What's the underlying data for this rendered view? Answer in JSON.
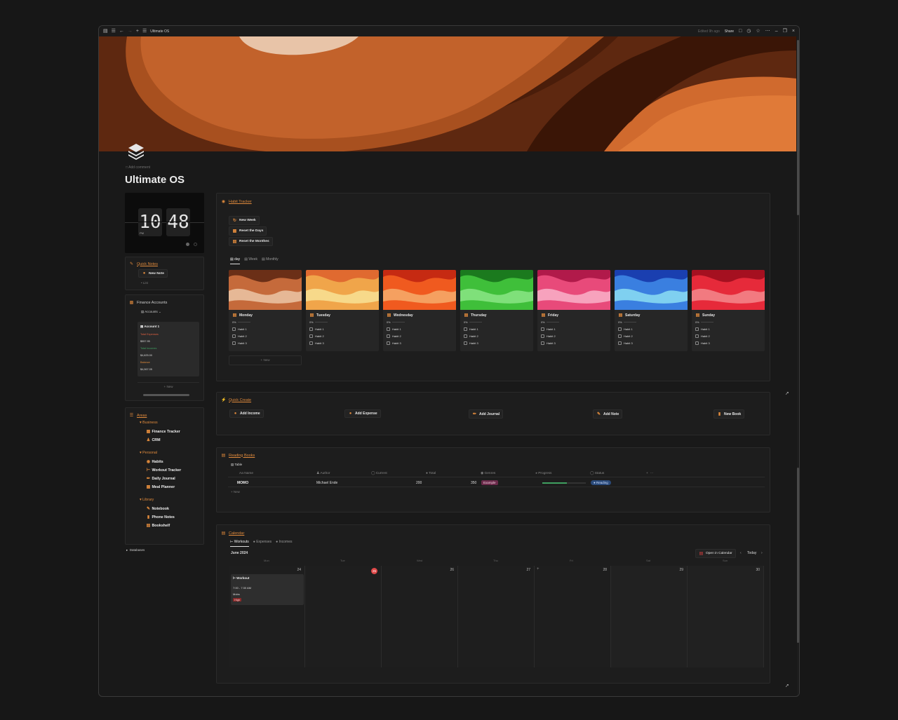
{
  "window": {
    "title": "Ultimate OS",
    "edited": "Edited 9h ago",
    "share": "Share"
  },
  "page": {
    "add_comment": "Add comment",
    "title": "Ultimate OS"
  },
  "clock": {
    "hours": "10",
    "minutes": "48",
    "ampm": "PM"
  },
  "quick_notes": {
    "title": "Quick Notes",
    "new_note": "New Note",
    "list_item": "List"
  },
  "finance": {
    "title": "Finance Accounts",
    "view": "Accounts",
    "account": "Account 1",
    "total_expenses_label": "Total Expenses",
    "total_expenses": "$557.95",
    "total_incomes_label": "Total Incomes",
    "total_incomes": "$4,625.00",
    "balance_label": "Balance",
    "balance": "$4,067.05",
    "new": "New"
  },
  "areas": {
    "title": "Areas",
    "business": "Business",
    "finance_tracker": "Finance Tracker",
    "crm": "CRM",
    "personal": "Personal",
    "habits": "Habits",
    "workout": "Workout Tracker",
    "journal": "Daily Journal",
    "meal": "Meal Planner",
    "library": "Library",
    "notebook": "Notebook",
    "phone_notes": "Phone Notes",
    "bookshelf": "Bookshelf",
    "databases": "Databases"
  },
  "habit": {
    "title": "Habit Tracker",
    "new_week": "New Week",
    "reset_days": "Reset the Days",
    "reset_months": "Reset the Monthes",
    "tabs": [
      "day",
      "Week",
      "Monthly"
    ],
    "new": "New",
    "days": [
      {
        "name": "Monday",
        "pct": "0%",
        "h1": "Habit 1",
        "h2": "Habit 2",
        "h3": "Habit 3",
        "c1": "#c56a3b",
        "c2": "#6b2f17",
        "c3": "#e6b896"
      },
      {
        "name": "Tuesday",
        "pct": "0%",
        "h1": "Habit 1",
        "h2": "Habit 2",
        "h3": "Habit 3",
        "c1": "#f0a54a",
        "c2": "#e06a30",
        "c3": "#f7d98a"
      },
      {
        "name": "Wednesday",
        "pct": "0%",
        "h1": "Habit 1",
        "h2": "Habit 2",
        "h3": "Habit 3",
        "c1": "#f05a1f",
        "c2": "#c62a12",
        "c3": "#f5a060"
      },
      {
        "name": "Thursday",
        "pct": "0%",
        "h1": "Habit 1",
        "h2": "Habit 2",
        "h3": "Habit 3",
        "c1": "#3fbf3a",
        "c2": "#1b7a1e",
        "c3": "#7fe07a"
      },
      {
        "name": "Friday",
        "pct": "0%",
        "h1": "Habit 1",
        "h2": "Habit 2",
        "h3": "Habit 3",
        "c1": "#e84a7a",
        "c2": "#b11a4a",
        "c3": "#f7a2bd"
      },
      {
        "name": "Saturday",
        "pct": "0%",
        "h1": "Habit 1",
        "h2": "Habit 2",
        "h3": "Habit 3",
        "c1": "#3a7fe0",
        "c2": "#1a3fb0",
        "c3": "#7fd0f0"
      },
      {
        "name": "Sunday",
        "pct": "0%",
        "h1": "Habit 1",
        "h2": "Habit 2",
        "h3": "Habit 3",
        "c1": "#e62a3a",
        "c2": "#a51020",
        "c3": "#f27a80"
      }
    ]
  },
  "quick_create": {
    "title": "Quick Create",
    "income": "Add Income",
    "expense": "Add Expense",
    "journal": "Add Journal",
    "note": "Add Note",
    "book": "New Book"
  },
  "reading": {
    "title": "Reading Books",
    "view": "Table",
    "cols": {
      "name": "Name",
      "author": "Author",
      "current": "Current",
      "total": "Total",
      "genres": "Genres",
      "progress": "Progress",
      "status": "Status"
    },
    "row": {
      "name": "MOMO",
      "author": "Michael Ende",
      "current": "200",
      "total": "350",
      "genre": "Example",
      "progress": 0.57,
      "status": "Reading"
    },
    "new": "New"
  },
  "calendar": {
    "title": "Calendar",
    "tabs": [
      "Workouts",
      "Expenses",
      "Incomes"
    ],
    "month": "June 2024",
    "open": "Open in Calendar",
    "today": "Today",
    "days": [
      "Mon",
      "Tue",
      "Wed",
      "Thu",
      "Fri",
      "Sat",
      "Sun"
    ],
    "nums": [
      "24",
      "25",
      "26",
      "27",
      "28",
      "29",
      "30"
    ],
    "event": {
      "title": "Workout",
      "time": "7:00 - 7:30 AM",
      "kind": "Mobs",
      "tag": "High"
    }
  },
  "colors": {
    "accent": "#e08a3c"
  }
}
